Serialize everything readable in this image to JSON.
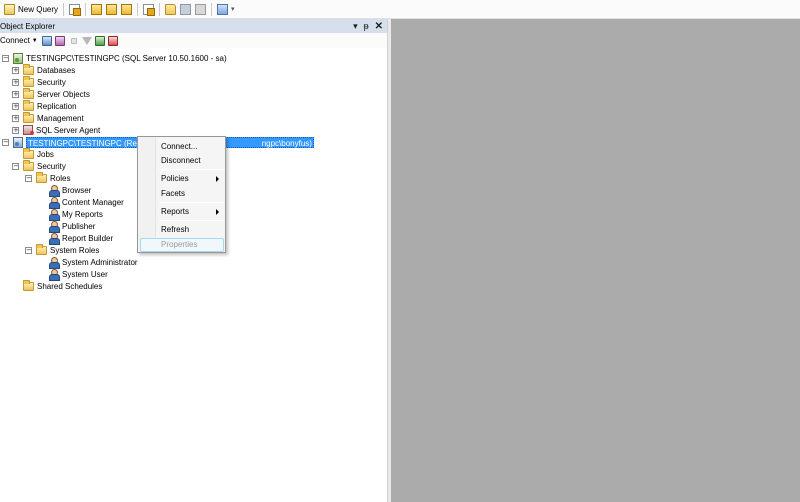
{
  "toolbar": {
    "new_query_label": "New Query",
    "icons": [
      "new-query-icon",
      "database-engine-query-icon",
      "analysis-mdx-icon",
      "analysis-dmx-icon",
      "analysis-xmla-icon",
      "sql-compact-query-icon",
      "open-file-icon",
      "save-icon",
      "print-icon",
      "activity-monitor-icon"
    ]
  },
  "object_explorer": {
    "title": "Object Explorer",
    "pin_glyph": "▾",
    "autohide_glyph": "ᵽ",
    "close_glyph": "✕",
    "connect_label": "Connect",
    "tree": {
      "server1": {
        "label": "TESTINGPC\\TESTINGPC (SQL Server 10.50.1600 - sa)"
      },
      "server1_children": [
        {
          "label": "Databases"
        },
        {
          "label": "Security"
        },
        {
          "label": "Server Objects"
        },
        {
          "label": "Replication"
        },
        {
          "label": "Management"
        },
        {
          "label": "SQL Server Agent"
        }
      ],
      "server2": {
        "label_left": "TESTINGPC\\TESTINGPC (Report",
        "label_right": "ngpc\\bonyfus)"
      },
      "jobs": "Jobs",
      "security": "Security",
      "roles": "Roles",
      "role_items": [
        {
          "label": "Browser"
        },
        {
          "label": "Content Manager"
        },
        {
          "label": "My Reports"
        },
        {
          "label": "Publisher"
        },
        {
          "label": "Report Builder"
        }
      ],
      "system_roles": "System Roles",
      "system_role_items": [
        {
          "label": "System Administrator"
        },
        {
          "label": "System User"
        }
      ],
      "shared_schedules": "Shared Schedules"
    }
  },
  "context_menu": {
    "items": [
      {
        "label": "Connect..."
      },
      {
        "label": "Disconnect"
      },
      {
        "label": "Policies"
      },
      {
        "label": "Facets"
      },
      {
        "label": "Reports"
      },
      {
        "label": "Refresh"
      },
      {
        "label": "Properties"
      }
    ]
  },
  "colors": {
    "selection": "#3399ff",
    "workarea": "#ababab",
    "panel_title": "#d6dfec"
  }
}
